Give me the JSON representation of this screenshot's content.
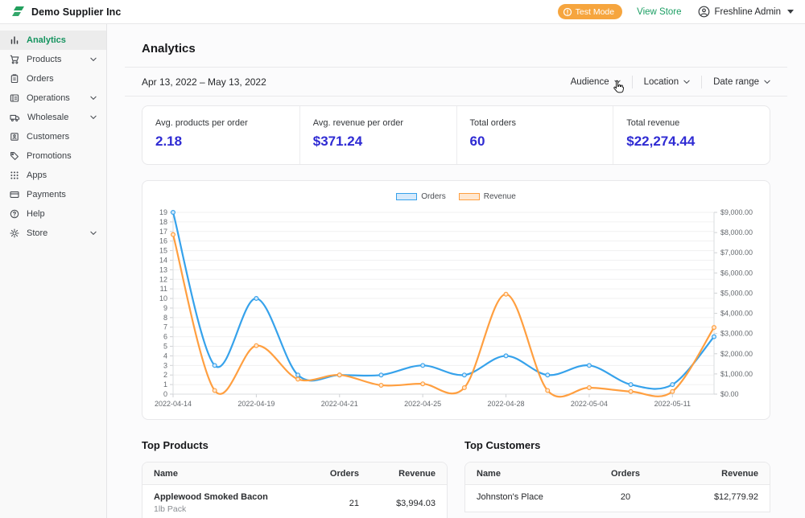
{
  "topbar": {
    "brand": "Demo Supplier Inc",
    "test_mode_label": "Test Mode",
    "view_store_label": "View Store",
    "account_label": "Freshline Admin"
  },
  "sidebar": {
    "items": [
      {
        "label": "Analytics",
        "icon": "bar-chart-icon",
        "selected": true,
        "expandable": false
      },
      {
        "label": "Products",
        "icon": "cart-icon",
        "selected": false,
        "expandable": true
      },
      {
        "label": "Orders",
        "icon": "clipboard-icon",
        "selected": false,
        "expandable": false
      },
      {
        "label": "Operations",
        "icon": "list-box-icon",
        "selected": false,
        "expandable": true
      },
      {
        "label": "Wholesale",
        "icon": "truck-icon",
        "selected": false,
        "expandable": true
      },
      {
        "label": "Customers",
        "icon": "person-card-icon",
        "selected": false,
        "expandable": false
      },
      {
        "label": "Promotions",
        "icon": "tag-icon",
        "selected": false,
        "expandable": false
      },
      {
        "label": "Apps",
        "icon": "grid-dots-icon",
        "selected": false,
        "expandable": false
      },
      {
        "label": "Payments",
        "icon": "credit-card-icon",
        "selected": false,
        "expandable": false
      },
      {
        "label": "Help",
        "icon": "help-circle-icon",
        "selected": false,
        "expandable": false
      },
      {
        "label": "Store",
        "icon": "gear-icon",
        "selected": false,
        "expandable": true
      }
    ]
  },
  "page": {
    "title": "Analytics",
    "date_range": "Apr 13, 2022 – May 13, 2022",
    "filters": [
      "Audience",
      "Location",
      "Date range"
    ]
  },
  "stats": [
    {
      "label": "Avg. products per order",
      "value": "2.18"
    },
    {
      "label": "Avg. revenue per order",
      "value": "$371.24"
    },
    {
      "label": "Total orders",
      "value": "60"
    },
    {
      "label": "Total revenue",
      "value": "$22,274.44"
    }
  ],
  "chart_data": {
    "type": "line",
    "categories": [
      "2022-04-14",
      "",
      "2022-04-19",
      "",
      "2022-04-21",
      "",
      "2022-04-25",
      "",
      "2022-04-28",
      "",
      "2022-05-04",
      "",
      "2022-05-11",
      ""
    ],
    "series": [
      {
        "name": "Orders",
        "axis": "left",
        "color": "#36a2eb",
        "fill": "#d7eafb",
        "values": [
          19,
          3,
          10,
          2,
          2,
          2,
          3,
          2,
          4,
          2,
          3,
          1,
          1,
          6
        ]
      },
      {
        "name": "Revenue",
        "axis": "right",
        "color": "#ff9f40",
        "fill": "#ffe8d1",
        "values": [
          7900,
          180,
          2400,
          740,
          950,
          440,
          510,
          320,
          4950,
          180,
          320,
          130,
          130,
          3300
        ]
      }
    ],
    "left_axis": {
      "min": 0,
      "max": 19,
      "step": 1
    },
    "right_axis": {
      "min": 0,
      "max": 9000,
      "step": 1000,
      "format": "currency"
    },
    "legend_position": "top",
    "grid": true
  },
  "top_products": {
    "title": "Top Products",
    "columns": [
      "Name",
      "Orders",
      "Revenue"
    ],
    "rows": [
      {
        "name": "Applewood Smoked Bacon",
        "variant": "1lb Pack",
        "orders": "21",
        "revenue": "$3,994.03"
      }
    ]
  },
  "top_customers": {
    "title": "Top Customers",
    "columns": [
      "Name",
      "Orders",
      "Revenue"
    ],
    "rows": [
      {
        "name": "Johnston's Place",
        "orders": "20",
        "revenue": "$12,779.92"
      }
    ]
  },
  "colors": {
    "brand_green": "#23a05e",
    "link_green": "#1b9e63",
    "test_mode_orange": "#f6a53e",
    "stat_value_indigo": "#2f2bd3",
    "orders_blue": "#36a2eb",
    "revenue_orange": "#ff9f40",
    "selected_nav_green": "#14935e"
  }
}
